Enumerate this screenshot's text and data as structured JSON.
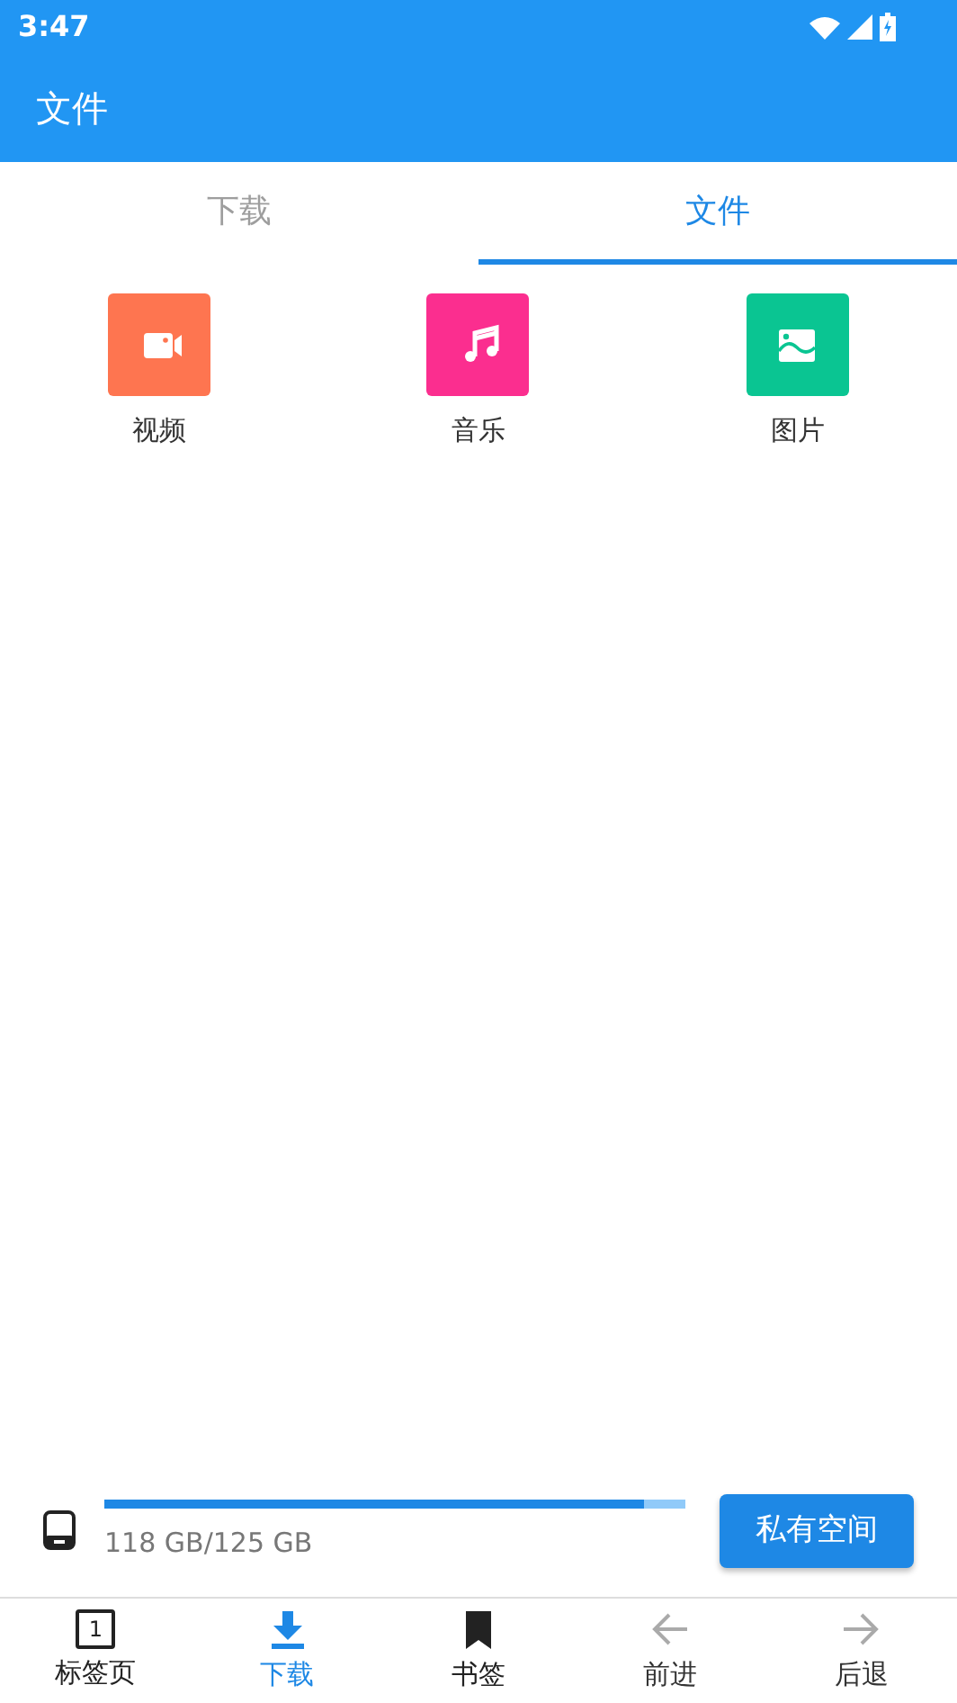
{
  "status_bar": {
    "time": "3:47"
  },
  "app_bar": {
    "title": "文件"
  },
  "tabs": [
    {
      "label": "下载",
      "selected": false
    },
    {
      "label": "文件",
      "selected": true
    }
  ],
  "categories": [
    {
      "label": "视频",
      "kind": "video",
      "color": "#fe7550"
    },
    {
      "label": "音乐",
      "kind": "music",
      "color": "#fb2e8f"
    },
    {
      "label": "图片",
      "kind": "image",
      "color": "#0ac592"
    }
  ],
  "storage": {
    "level": 0.93,
    "reading": "118 GB/125 GB",
    "button": "私有空间"
  },
  "bottom_nav": [
    {
      "label": "标签页",
      "kind": "tabs",
      "count": "1",
      "selected": false,
      "disabled": false
    },
    {
      "label": "下载",
      "kind": "download",
      "selected": true,
      "disabled": false
    },
    {
      "label": "书签",
      "kind": "bookmark",
      "selected": false,
      "disabled": false
    },
    {
      "label": "前进",
      "kind": "back",
      "selected": false,
      "disabled": true
    },
    {
      "label": "后退",
      "kind": "forward",
      "selected": false,
      "disabled": true
    }
  ]
}
